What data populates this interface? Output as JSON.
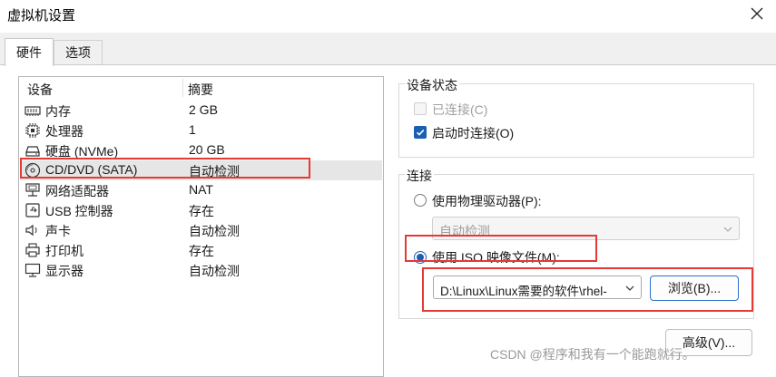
{
  "window": {
    "title": "虚拟机设置"
  },
  "tabs": [
    {
      "label": "硬件"
    },
    {
      "label": "选项"
    }
  ],
  "device_list": {
    "headers": {
      "device": "设备",
      "summary": "摘要"
    },
    "rows": [
      {
        "name": "内存",
        "summary": "2 GB",
        "icon": "memory-icon"
      },
      {
        "name": "处理器",
        "summary": "1",
        "icon": "cpu-icon"
      },
      {
        "name": "硬盘 (NVMe)",
        "summary": "20 GB",
        "icon": "hard-disk-icon"
      },
      {
        "name": "CD/DVD (SATA)",
        "summary": "自动检测",
        "icon": "cd-dvd-icon",
        "selected": true
      },
      {
        "name": "网络适配器",
        "summary": "NAT",
        "icon": "network-adapter-icon"
      },
      {
        "name": "USB 控制器",
        "summary": "存在",
        "icon": "usb-icon"
      },
      {
        "name": "声卡",
        "summary": "自动检测",
        "icon": "speaker-icon"
      },
      {
        "name": "打印机",
        "summary": "存在",
        "icon": "printer-icon"
      },
      {
        "name": "显示器",
        "summary": "自动检测",
        "icon": "monitor-icon"
      }
    ]
  },
  "device_status": {
    "title": "设备状态",
    "connected": {
      "label": "已连接(C)",
      "checked": false,
      "disabled": true
    },
    "connect_at_power_on": {
      "label": "启动时连接(O)",
      "checked": true
    }
  },
  "connection": {
    "title": "连接",
    "physical_drive": {
      "label": "使用物理驱动器(P):",
      "checked": false,
      "dropdown_value": "自动检测"
    },
    "iso_image": {
      "label": "使用 ISO 映像文件(M):",
      "checked": true,
      "path_value": "D:\\Linux\\Linux需要的软件\\rhel-",
      "browse_label": "浏览(B)..."
    }
  },
  "advanced_button": {
    "label": "高级(V)..."
  },
  "watermark": "CSDN @程序和我有一个能跑就行。",
  "colors": {
    "accent": "#1a5fb4",
    "highlight_box": "#e53935",
    "selected_row": "#e6e6e6"
  }
}
